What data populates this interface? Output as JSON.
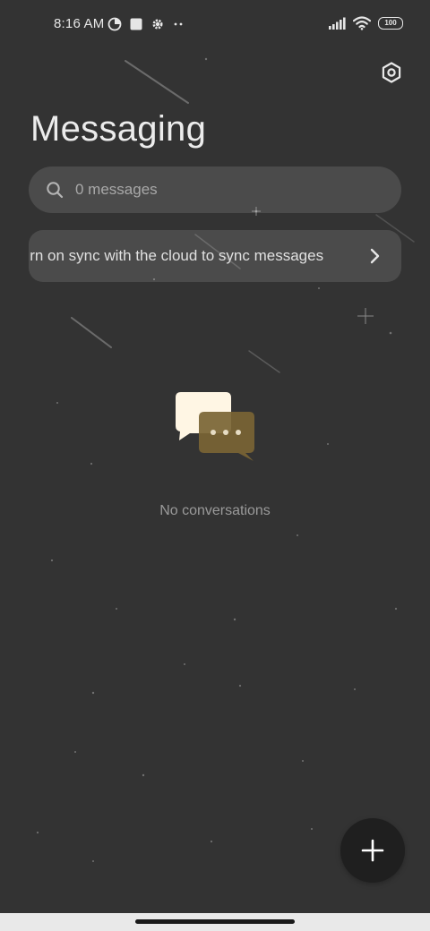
{
  "status_bar": {
    "time": "8:16 AM",
    "left_icons": [
      "data-saver-icon",
      "square-notification-icon",
      "gear-notification-icon",
      "more-dots-icon"
    ],
    "right_icons": [
      "signal-icon",
      "wifi-icon",
      "battery-icon"
    ],
    "battery_level": "100"
  },
  "header": {
    "title": "Messaging",
    "settings_icon": "settings-hexagon-icon"
  },
  "search": {
    "placeholder": "0 messages",
    "icon": "search-icon"
  },
  "sync_banner": {
    "text": "Turn on sync with the cloud to sync messages",
    "icon": "chevron-right-icon"
  },
  "empty_state": {
    "icon": "chat-bubbles-icon",
    "text": "No conversations"
  },
  "fab": {
    "icon": "plus-icon"
  },
  "colors": {
    "background": "#333333",
    "card": "#474747",
    "bubble_front": "#fff6e4",
    "bubble_back": "#7a6434",
    "fab": "#1f1f1f"
  }
}
